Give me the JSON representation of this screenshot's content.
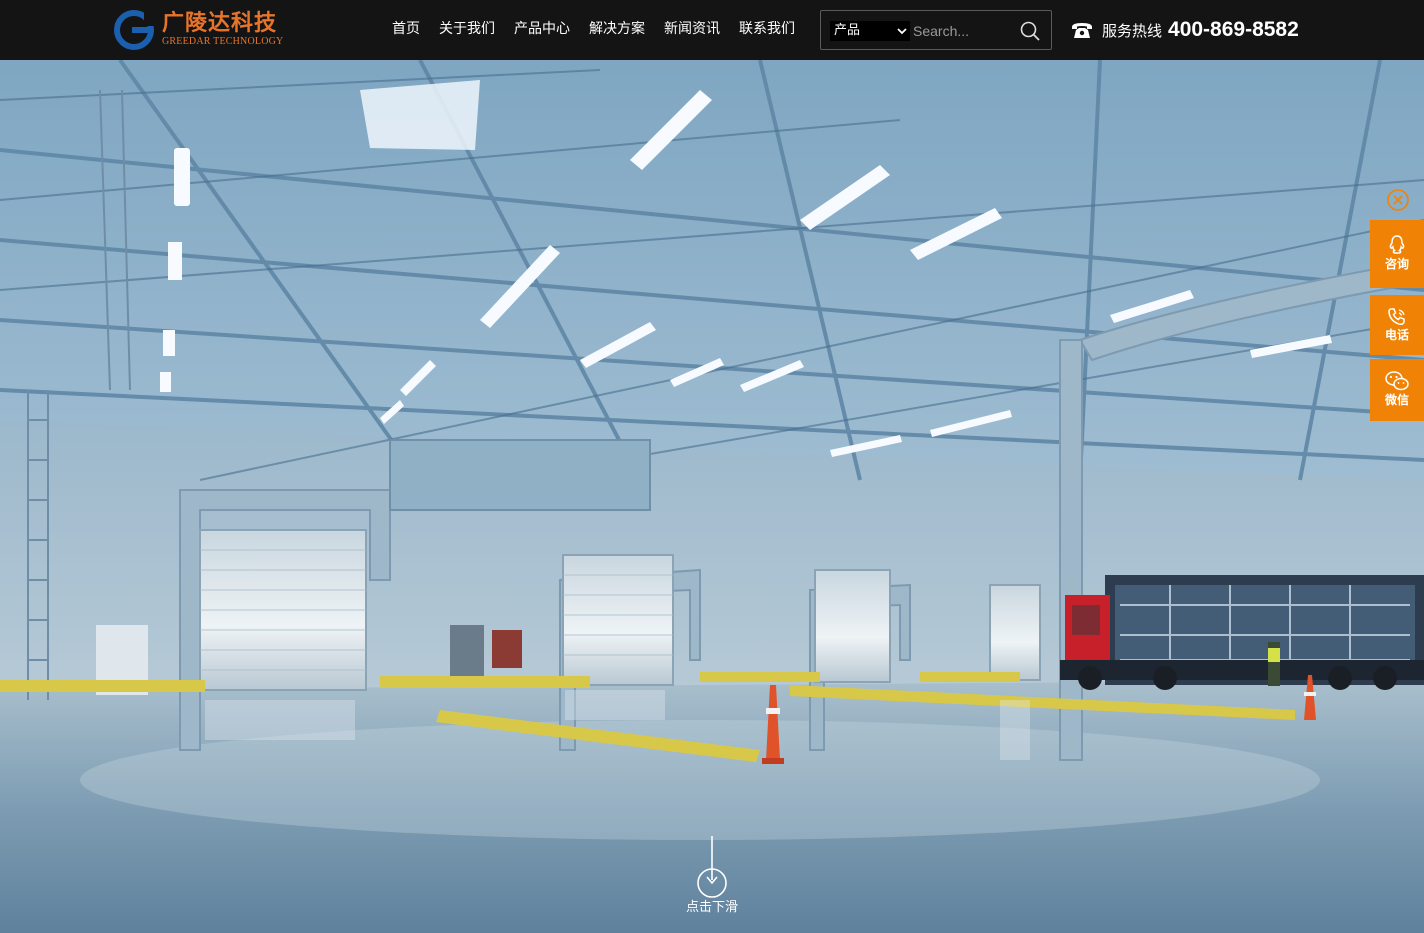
{
  "brand": {
    "name_cn": "广陵达科技",
    "name_en": "GREEDAR TECHNOLOGY",
    "icon": "logo-g-icon"
  },
  "nav": [
    {
      "label": "首页"
    },
    {
      "label": "关于我们"
    },
    {
      "label": "产品中心"
    },
    {
      "label": "解决方案"
    },
    {
      "label": "新闻资讯"
    },
    {
      "label": "联系我们"
    }
  ],
  "search": {
    "category_selected": "产品",
    "placeholder": "Search...",
    "icon": "search-icon"
  },
  "hotline": {
    "label": "服务热线",
    "number": "400-869-8582",
    "icon": "phone-icon"
  },
  "hero": {
    "scroll_label": "点击下滑",
    "slide_count": 3,
    "active_slide": 2
  },
  "side_float": [
    {
      "label": "咨询",
      "icon": "qq-icon"
    },
    {
      "label": "电话",
      "icon": "phone-icon"
    },
    {
      "label": "微信",
      "icon": "wechat-icon"
    }
  ],
  "colors": {
    "header_bg": "#141414",
    "accent_orange": "#f08306",
    "logo_orange": "#e8742a",
    "logo_blue": "#1b5fae",
    "dot_active": "#d71e26"
  }
}
